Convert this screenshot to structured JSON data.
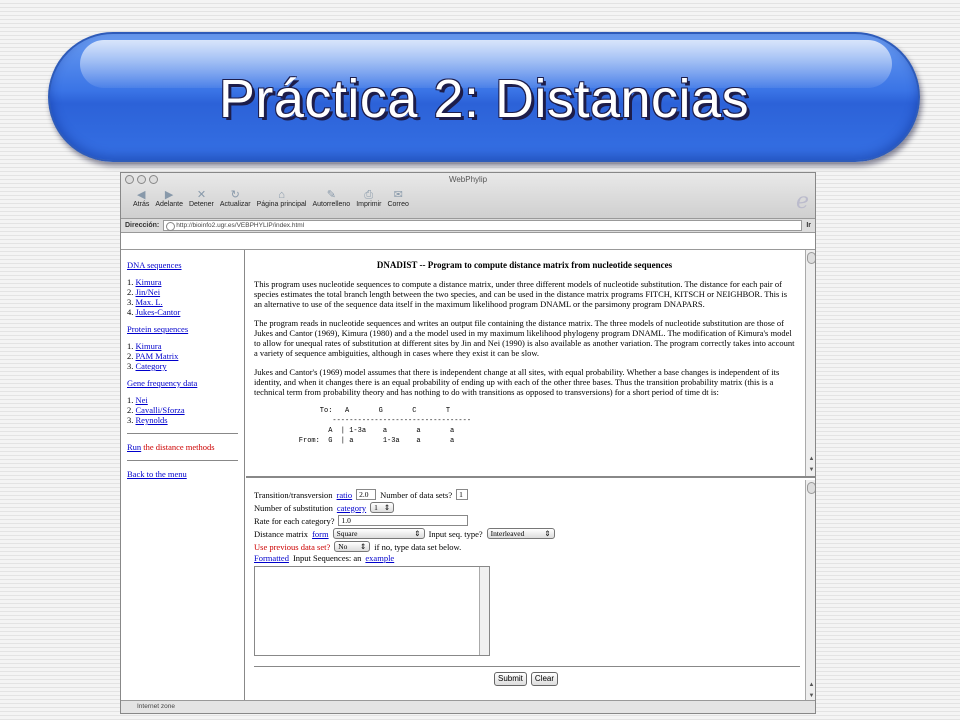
{
  "slide": {
    "title": "Práctica 2: Distancias"
  },
  "browser": {
    "window_title": "WebPhylip",
    "toolbar": [
      "Atrás",
      "Adelante",
      "Detener",
      "Actualizar",
      "Página principal",
      "Autorrelleno",
      "Imprimir",
      "Correo"
    ],
    "address_label": "Dirección:",
    "url": "http://bioinfo2.ugr.es/VEBPHYLIP/index.html",
    "go": "Ir",
    "status": "Internet zone"
  },
  "sidebar": {
    "dna_title": "DNA sequences",
    "dna_items": [
      {
        "num": "1.",
        "label": "Kimura"
      },
      {
        "num": "2.",
        "label": "Jin/Nei"
      },
      {
        "num": "3.",
        "label": "Max. L."
      },
      {
        "num": "4.",
        "label": "Jukes-Cantor"
      }
    ],
    "protein_title": "Protein sequences",
    "protein_items": [
      {
        "num": "1.",
        "label": "Kimura"
      },
      {
        "num": "2.",
        "label": "PAM Matrix"
      },
      {
        "num": "3.",
        "label": "Category"
      }
    ],
    "gene_title": "Gene frequency data",
    "gene_items": [
      {
        "num": "1.",
        "label": "Nei"
      },
      {
        "num": "2.",
        "label": "Cavalli/Sforza"
      },
      {
        "num": "3.",
        "label": "Reynolds"
      }
    ],
    "run_link": "Run",
    "run_text": "the distance methods",
    "back_link": "Back to the menu"
  },
  "doc": {
    "heading": "DNADIST -- Program to compute distance matrix from nucleotide sequences",
    "p1": "This program uses nucleotide sequences to compute a distance matrix, under three different models of nucleotide substitution. The distance for each pair of species estimates the total branch length between the two species, and can be used in the distance matrix programs FITCH, KITSCH or NEIGHBOR. This is an alternative to use of the sequence data itself in the maximum likelihood program DNAML or the parsimony program DNAPARS.",
    "p2": "The program reads in nucleotide sequences and writes an output file containing the distance matrix. The three models of nucleotide substitution are those of Jukes and Cantor (1969), Kimura (1980) and a the model used in my maximum likelihood phylogeny program DNAML. The modification of Kimura's model to allow for unequal rates of substitution at different sites by Jin and Nei (1990) is also available as another variation. The program correctly takes into account a variety of sequence ambiguities, although in cases where they exist it can be slow.",
    "p3": "Jukes and Cantor's (1969) model assumes that there is independent change at all sites, with equal probability. Whether a base changes is independent of its identity, and when it changes there is an equal probability of ending up with each of the other three bases. Thus the transition probability matrix (this is a technical term from probability theory and has nothing to do with transitions as opposed to transversions) for a short period of time dt is:",
    "matrix": "         To:   A       G       C       T\n            ---------------------------------\n           A  | 1-3a    a       a       a\n    From:  G  | a       1-3a    a       a"
  },
  "form": {
    "ratio_pre": "Transition/transversion",
    "ratio_link": "ratio",
    "ratio_value": "2.0",
    "datasets_label": "Number of data sets?",
    "datasets_value": "1",
    "subst_pre": "Number of substitution",
    "subst_link": "category",
    "subst_value": "1",
    "rate_label": "Rate for each category?",
    "rate_value": "1.0",
    "dm_pre": "Distance matrix",
    "dm_link": "form",
    "dm_value": "Square",
    "seq_type_label": "Input seq. type?",
    "seq_type_value": "Interleaved",
    "prev_label": "Use previous data set?",
    "prev_value": "No",
    "prev_note": "if no, type data set below.",
    "formatted_link": "Formatted",
    "input_text": "Input Sequences: an",
    "example_link": "example",
    "submit": "Submit",
    "clear": "Clear"
  }
}
